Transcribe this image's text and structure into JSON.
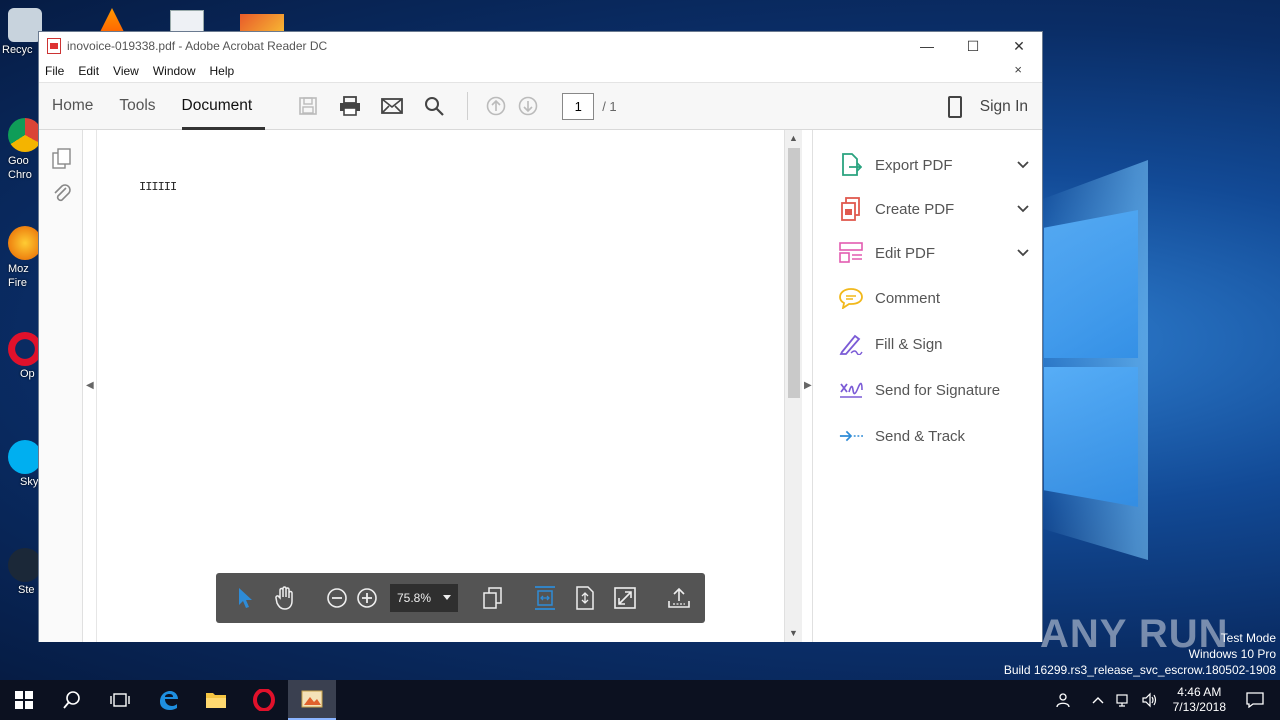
{
  "window": {
    "title": "inovoice-019338.pdf - Adobe Acrobat Reader DC",
    "minimize": "—",
    "maximize": "☐",
    "close": "✕"
  },
  "menu": {
    "items": [
      "File",
      "Edit",
      "View",
      "Window",
      "Help"
    ],
    "close_doc": "×"
  },
  "toolbar": {
    "tabs": [
      "Home",
      "Tools",
      "Document"
    ],
    "active_tab": "Document",
    "page_current": "1",
    "page_total": "/ 1",
    "sign_in": "Sign In"
  },
  "document": {
    "content_text": "IIIIII"
  },
  "tools_pane": [
    {
      "label": "Export PDF",
      "icon": "export-pdf-icon",
      "has_chevron": true,
      "color": "#2aa37f"
    },
    {
      "label": "Create PDF",
      "icon": "create-pdf-icon",
      "has_chevron": true,
      "color": "#e05a4f"
    },
    {
      "label": "Edit PDF",
      "icon": "edit-pdf-icon",
      "has_chevron": true,
      "color": "#e25bb0"
    },
    {
      "label": "Comment",
      "icon": "comment-icon",
      "has_chevron": false,
      "color": "#f1b81b"
    },
    {
      "label": "Fill & Sign",
      "icon": "fill-sign-icon",
      "has_chevron": false,
      "color": "#7b5bd6"
    },
    {
      "label": "Send for Signature",
      "icon": "send-signature-icon",
      "has_chevron": false,
      "color": "#7b5bd6"
    },
    {
      "label": "Send & Track",
      "icon": "send-track-icon",
      "has_chevron": false,
      "color": "#2e8bd6"
    }
  ],
  "floating_toolbar": {
    "zoom": "75.8%"
  },
  "desktop": {
    "icons": [
      "Recyc",
      "Goo Chro",
      "Moz Fire",
      "Op",
      "Sky",
      "Ste"
    ],
    "watermark": "ANY RUN",
    "sysinfo": [
      "Test Mode",
      "Windows 10 Pro",
      "Build 16299.rs3_release_svc_escrow.180502-1908"
    ]
  },
  "taskbar": {
    "time": "4:46 AM",
    "date": "7/13/2018"
  },
  "colors": {
    "accent_blue": "#2e8bd6",
    "floatbar_bg": "#545454"
  }
}
